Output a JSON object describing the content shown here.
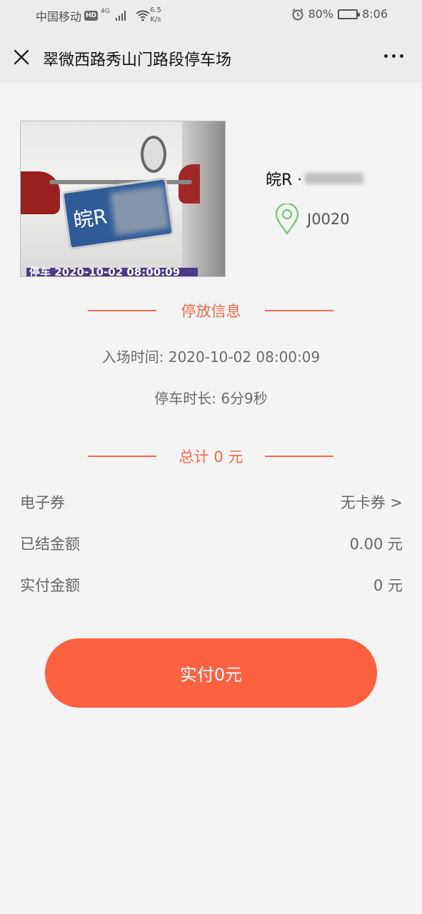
{
  "status_bar": {
    "carrier": "中国移动",
    "hd": "HD",
    "network": "4G",
    "speed_value": "6.5",
    "speed_unit": "K/s",
    "battery": "80%",
    "battery_level": 0.8,
    "time": "8:06"
  },
  "nav": {
    "title": "翠微西路秀山门路段停车场"
  },
  "car": {
    "plate_visible": "皖R",
    "plate_prefix": "皖R ·",
    "photo_stamp": "停车 2020-10-02 08:00:09",
    "spot": "J0020"
  },
  "parking_info": {
    "section_title": "停放信息",
    "entry_label": "入场时间: ",
    "entry_time": "2020-10-02 08:00:09",
    "duration_label": "停车时长: ",
    "duration": "6分9秒"
  },
  "total": {
    "label": "总计 0 元"
  },
  "rows": [
    {
      "label": "电子券",
      "value": "无卡券 >"
    },
    {
      "label": "已结金额",
      "value": "0.00 元"
    },
    {
      "label": "实付金额",
      "value": "0 元"
    }
  ],
  "pay_button": {
    "label": "实付0元"
  },
  "colors": {
    "accent": "#f26849",
    "button": "#fe6140",
    "pin": "#7dc87d"
  }
}
